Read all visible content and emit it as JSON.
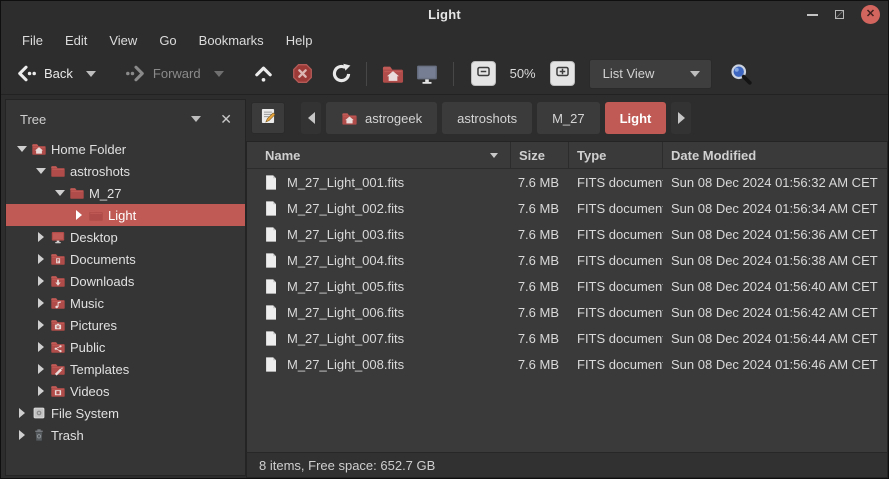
{
  "window": {
    "title": "Light",
    "controls": {
      "minimize": "minimize",
      "maximize": "maximize",
      "close": "close"
    }
  },
  "menu_bar": {
    "items": [
      "File",
      "Edit",
      "View",
      "Go",
      "Bookmarks",
      "Help"
    ]
  },
  "toolbar": {
    "back_label": "Back",
    "forward_label": "Forward",
    "forward_enabled": false,
    "zoom_level": "50%",
    "view_mode": "List View"
  },
  "sidebar": {
    "header": "Tree",
    "items": [
      {
        "label": "Home Folder",
        "depth": 0,
        "expanded": true,
        "selected": false,
        "icon": "home-folder"
      },
      {
        "label": "astroshots",
        "depth": 1,
        "expanded": true,
        "selected": false,
        "icon": "folder"
      },
      {
        "label": "M_27",
        "depth": 2,
        "expanded": true,
        "selected": false,
        "icon": "folder"
      },
      {
        "label": "Light",
        "depth": 3,
        "expanded": false,
        "selected": true,
        "icon": "folder"
      },
      {
        "label": "Desktop",
        "depth": 1,
        "expanded": false,
        "selected": false,
        "icon": "desktop"
      },
      {
        "label": "Documents",
        "depth": 1,
        "expanded": false,
        "selected": false,
        "icon": "folder-documents"
      },
      {
        "label": "Downloads",
        "depth": 1,
        "expanded": false,
        "selected": false,
        "icon": "folder-downloads"
      },
      {
        "label": "Music",
        "depth": 1,
        "expanded": false,
        "selected": false,
        "icon": "folder-music"
      },
      {
        "label": "Pictures",
        "depth": 1,
        "expanded": false,
        "selected": false,
        "icon": "folder-pictures"
      },
      {
        "label": "Public",
        "depth": 1,
        "expanded": false,
        "selected": false,
        "icon": "folder-public"
      },
      {
        "label": "Templates",
        "depth": 1,
        "expanded": false,
        "selected": false,
        "icon": "folder-templates"
      },
      {
        "label": "Videos",
        "depth": 1,
        "expanded": false,
        "selected": false,
        "icon": "folder-videos"
      },
      {
        "label": "File System",
        "depth": 0,
        "expanded": false,
        "selected": false,
        "icon": "drive"
      },
      {
        "label": "Trash",
        "depth": 0,
        "expanded": false,
        "selected": false,
        "icon": "trash"
      }
    ]
  },
  "path_bar": {
    "breadcrumbs": [
      {
        "label": "astrogeek",
        "icon": "home-folder",
        "active": false
      },
      {
        "label": "astroshots",
        "icon": null,
        "active": false
      },
      {
        "label": "M_27",
        "icon": null,
        "active": false
      },
      {
        "label": "Light",
        "icon": null,
        "active": true
      }
    ]
  },
  "file_list": {
    "columns": [
      "Name",
      "Size",
      "Type",
      "Date Modified"
    ],
    "sort_column": "Name",
    "sort_direction": "descending-arrow",
    "rows": [
      {
        "name": "M_27_Light_001.fits",
        "size": "7.6 MB",
        "type": "FITS document",
        "date_modified": "Sun 08 Dec 2024 01:56:32 AM CET"
      },
      {
        "name": "M_27_Light_002.fits",
        "size": "7.6 MB",
        "type": "FITS document",
        "date_modified": "Sun 08 Dec 2024 01:56:34 AM CET"
      },
      {
        "name": "M_27_Light_003.fits",
        "size": "7.6 MB",
        "type": "FITS document",
        "date_modified": "Sun 08 Dec 2024 01:56:36 AM CET"
      },
      {
        "name": "M_27_Light_004.fits",
        "size": "7.6 MB",
        "type": "FITS document",
        "date_modified": "Sun 08 Dec 2024 01:56:38 AM CET"
      },
      {
        "name": "M_27_Light_005.fits",
        "size": "7.6 MB",
        "type": "FITS document",
        "date_modified": "Sun 08 Dec 2024 01:56:40 AM CET"
      },
      {
        "name": "M_27_Light_006.fits",
        "size": "7.6 MB",
        "type": "FITS document",
        "date_modified": "Sun 08 Dec 2024 01:56:42 AM CET"
      },
      {
        "name": "M_27_Light_007.fits",
        "size": "7.6 MB",
        "type": "FITS document",
        "date_modified": "Sun 08 Dec 2024 01:56:44 AM CET"
      },
      {
        "name": "M_27_Light_008.fits",
        "size": "7.6 MB",
        "type": "FITS document",
        "date_modified": "Sun 08 Dec 2024 01:56:46 AM CET"
      }
    ]
  },
  "status_bar": {
    "text": "8 items, Free space: 652.7 GB"
  },
  "icons": {
    "back": "left-chevron-with-dots",
    "forward": "right-chevron-with-dots",
    "up": "chevron-up-with-dot",
    "stop": "red-octagon-x",
    "refresh": "circular-arrow",
    "home-folder": "red-folder-with-house",
    "desktop-monitor": "gray-monitor",
    "zoom-out": "minus-in-square",
    "zoom-in": "plus-in-square",
    "search": "magnifier-blue-lens",
    "edit-path": "page-with-pencil",
    "document": "white-page-folded-corner",
    "folder": "red-folder",
    "drive": "gray-disk",
    "trash": "trash-can"
  },
  "colors": {
    "accent_red": "#bf5a55",
    "folder_red": "#b04c49",
    "close_button": "#d2665f",
    "window_bg": "#2d2d2d",
    "pane_bg": "#3a3a3a",
    "sidebar_bg": "#353535"
  }
}
